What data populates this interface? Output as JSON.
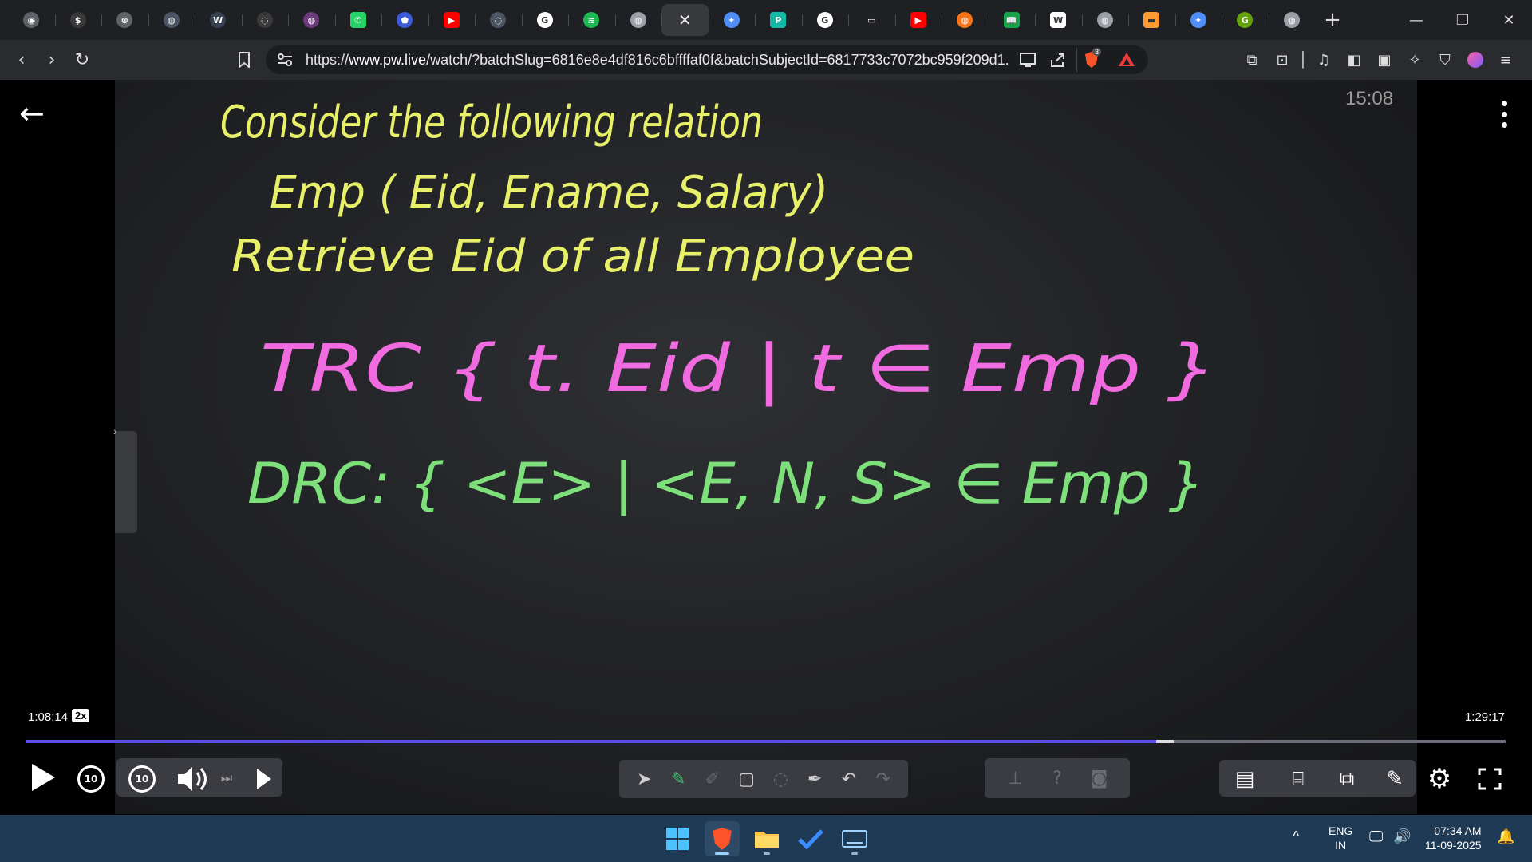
{
  "browser": {
    "tabs": [
      {
        "icon": "chatgpt-icon",
        "color": "#5f6368",
        "active": false
      },
      {
        "icon": "circle-dollar-icon",
        "color": "#3a3a3a",
        "active": false
      },
      {
        "icon": "openai-icon",
        "color": "#5f6368",
        "active": false
      },
      {
        "icon": "globe-icon",
        "color": "#4b5563",
        "active": false
      },
      {
        "icon": "w3schools-icon",
        "color": "#374151",
        "active": false
      },
      {
        "icon": "globe-icon",
        "color": "#3a3a3a",
        "active": false
      },
      {
        "icon": "purple-globe-icon",
        "color": "#6b3a7a",
        "active": false
      },
      {
        "icon": "whatsapp-icon",
        "color": "#25d366",
        "active": false
      },
      {
        "icon": "bookmark-icon",
        "color": "#3b5bdb",
        "active": false
      },
      {
        "icon": "youtube-icon",
        "color": "#ff0000",
        "active": false
      },
      {
        "icon": "globe-icon",
        "color": "#4b5563",
        "active": false
      },
      {
        "icon": "google-icon",
        "color": "#ffffff",
        "active": false
      },
      {
        "icon": "spotify-icon",
        "color": "#1db954",
        "active": false
      },
      {
        "icon": "globe-icon",
        "color": "#9aa0a6",
        "active": false
      },
      {
        "icon": "close-icon",
        "color": "#38393d",
        "active": true
      },
      {
        "icon": "gemini-icon",
        "color": "#4f8ef7",
        "active": false
      },
      {
        "icon": "p-icon",
        "color": "#14b8a6",
        "active": false
      },
      {
        "icon": "google-icon",
        "color": "#ffffff",
        "active": false
      },
      {
        "icon": "screen-icon",
        "color": "#202124",
        "active": false
      },
      {
        "icon": "youtube-icon",
        "color": "#ff0000",
        "active": false
      },
      {
        "icon": "orange-globe-icon",
        "color": "#f97316",
        "active": false
      },
      {
        "icon": "green-book-icon",
        "color": "#16a34a",
        "active": false
      },
      {
        "icon": "wikipedia-icon",
        "color": "#ffffff",
        "active": false
      },
      {
        "icon": "globe-icon",
        "color": "#9aa0a6",
        "active": false
      },
      {
        "icon": "india-flag-icon",
        "color": "#ff9933",
        "active": false
      },
      {
        "icon": "gemini-icon",
        "color": "#4f8ef7",
        "active": false
      },
      {
        "icon": "g-icon",
        "color": "#65a30d",
        "active": false
      },
      {
        "icon": "globe-icon",
        "color": "#9aa0a6",
        "active": false
      }
    ],
    "tab_glyphs": [
      "◉",
      "$",
      "⊛",
      "◍",
      "W",
      "◌",
      "◍",
      "✆",
      "⬟",
      "▶",
      "◌",
      "G",
      "≋",
      "◍",
      "✕",
      "✦",
      "P",
      "G",
      "▭",
      "▶",
      "◍",
      "📖",
      "W",
      "◍",
      "▬",
      "✦",
      "G",
      "◍"
    ],
    "new_tab": "+",
    "window": {
      "minimize": "—",
      "restore": "❐",
      "close": "✕"
    },
    "nav": {
      "back": "‹",
      "forward": "›",
      "reload": "↻",
      "bookmark": "🔖"
    },
    "url": "https://www.pw.live/watch/?batchSlug=6816e8e4df816c6bffffaf0f&batchSubjectId=6817733c7072bc959f209d1...",
    "url_prefix": "https://",
    "url_host": "www.pw.live",
    "url_rest": "/watch/?batchSlug=6816e8e4df816c6bffffaf0f&batchSubjectId=6817733c7072bc959f209d1...",
    "shield_badge": "3"
  },
  "player": {
    "clock": "15:08",
    "current_time": "1:08:14",
    "speed": "2x",
    "total_time": "1:29:17",
    "progress_fraction": 0.764,
    "buffer_fraction": 0.776,
    "rewind_label": "10",
    "forward_label": "10",
    "board": {
      "line1": "Consider the following relation",
      "line2": "Emp ( Eid, Ename, Salary)",
      "line3": "Retrieve Eid of all Employee",
      "trc": "TRC { t. Eid | t ∈ Emp }",
      "drc": "DRC: { <E> | <E, N, S> ∈ Emp }",
      "colors": {
        "yellow": "#e8f06a",
        "magenta": "#f06ae0",
        "green": "#7ee07a"
      }
    }
  },
  "taskbar": {
    "lang": "ENG",
    "region": "IN",
    "time": "07:34 AM",
    "date": "11-09-2025",
    "chevron": "^"
  }
}
